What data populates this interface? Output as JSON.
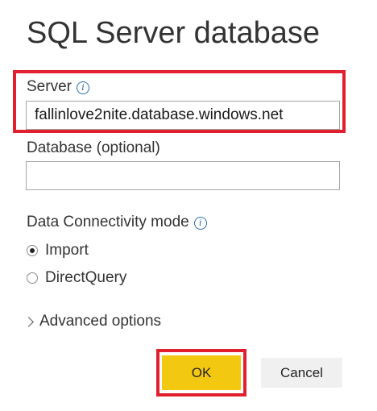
{
  "dialog": {
    "title": "SQL Server database",
    "server": {
      "label": "Server",
      "value": "fallinlove2nite.database.windows.net",
      "info_icon": "info-icon"
    },
    "database": {
      "label": "Database (optional)",
      "value": ""
    },
    "connectivity": {
      "label": "Data Connectivity mode",
      "info_icon": "info-icon",
      "options": [
        {
          "label": "Import",
          "selected": true
        },
        {
          "label": "DirectQuery",
          "selected": false
        }
      ]
    },
    "advanced_label": "Advanced options",
    "ok_label": "OK",
    "cancel_label": "Cancel"
  },
  "colors": {
    "ok_button": "#f2c811",
    "highlight": "#e0202e",
    "info_icon": "#2b6cb0",
    "cancel_button": "#f0f0f0"
  }
}
